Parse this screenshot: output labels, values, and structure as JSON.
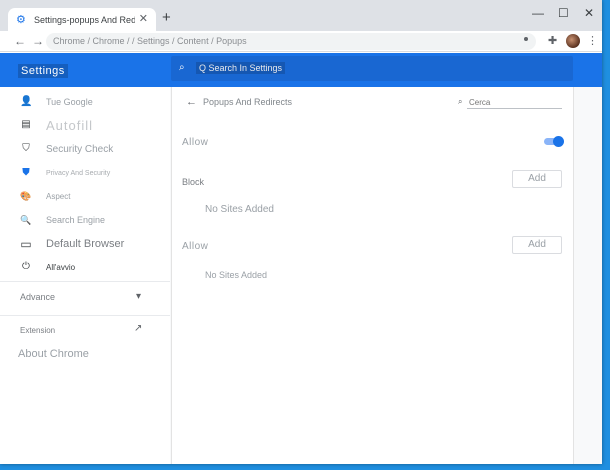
{
  "tab": {
    "title": "Settings-popups And Redirects",
    "close": "✕"
  },
  "newtab": "+",
  "window_controls": {
    "minimize": "—",
    "maximize": "☐",
    "close": "✕"
  },
  "toolbar": {
    "back": "←",
    "forward": "→",
    "address": "Chrome / Chrome / / Settings / Content / Popups",
    "kebab": "⋮"
  },
  "header": {
    "title": "Settings",
    "search_placeholder": "Q Search In Settings"
  },
  "sidebar": {
    "items": [
      {
        "label": "Tue Google",
        "icon": "person-icon",
        "glyph": "👤"
      },
      {
        "label": "Autofill",
        "icon": "clipboard-icon",
        "glyph": "▤"
      },
      {
        "label": "Security Check",
        "icon": "shield-check-icon",
        "glyph": "⛉"
      },
      {
        "label": "Privacy And Security",
        "icon": "shield-icon",
        "glyph": "⛊"
      },
      {
        "label": "Aspect",
        "icon": "palette-icon",
        "glyph": "🎨"
      },
      {
        "label": "Search Engine",
        "icon": "search-icon",
        "glyph": "🔍"
      },
      {
        "label": "Default Browser",
        "icon": "browser-icon",
        "glyph": "▭"
      },
      {
        "label": "All'avvio",
        "icon": "power-icon",
        "glyph": "⏻"
      }
    ],
    "advanced": "Advance",
    "advanced_chevron": "▾",
    "extension": "Extension",
    "extension_link": "↗",
    "about": "About Chrome"
  },
  "main": {
    "back": "←",
    "title": "Popups And Redirects",
    "search_placeholder": "Cerca",
    "allow_toggle_label": "Allow",
    "allow_toggle_on": true,
    "block_label": "Block",
    "block_add": "Add",
    "block_empty": "No Sites Added",
    "allow_label": "Allow",
    "allow_add": "Add",
    "allow_empty": "No Sites Added"
  },
  "colors": {
    "accent": "#1a73e8",
    "desktop": "#1f8fe0"
  }
}
